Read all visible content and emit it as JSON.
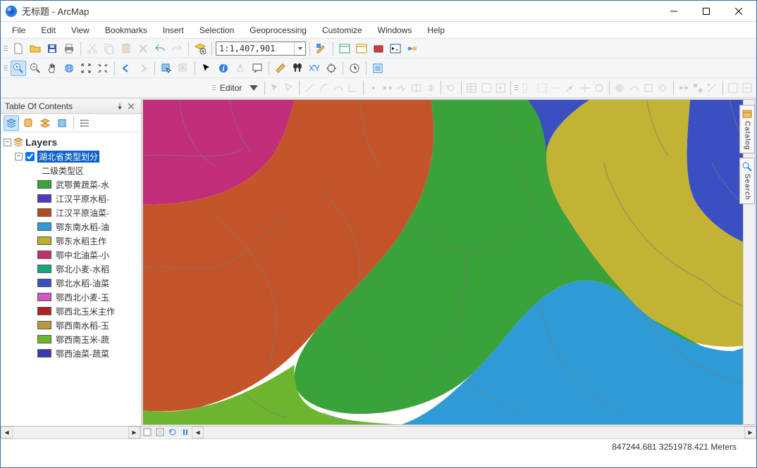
{
  "window": {
    "title": "无标题 - ArcMap"
  },
  "menu": {
    "items": [
      "File",
      "Edit",
      "View",
      "Bookmarks",
      "Insert",
      "Selection",
      "Geoprocessing",
      "Customize",
      "Windows",
      "Help"
    ]
  },
  "scale": {
    "value": "1:1,407,901"
  },
  "editor": {
    "label": "Editor"
  },
  "toc": {
    "title": "Table Of Contents",
    "root": "Layers",
    "layer": "湖北省类型划分",
    "field": "二级类型区",
    "symbols": [
      {
        "color": "#3aa23a",
        "label": "武鄂黄蔬菜-水"
      },
      {
        "color": "#4a3bbf",
        "label": "江汉平原水稻-"
      },
      {
        "color": "#b24a21",
        "label": "江汉平原油菜-"
      },
      {
        "color": "#2e9bd6",
        "label": "鄂东南水稻-油"
      },
      {
        "color": "#b8b02e",
        "label": "鄂东水稻主作"
      },
      {
        "color": "#c22e6e",
        "label": "鄂中北油菜-小"
      },
      {
        "color": "#1aa87a",
        "label": "鄂北小麦-水稻"
      },
      {
        "color": "#3a50c2",
        "label": "鄂北水稻-油菜"
      },
      {
        "color": "#d05ac2",
        "label": "鄂西北小麦-玉"
      },
      {
        "color": "#b02222",
        "label": "鄂西北玉米主作"
      },
      {
        "color": "#b89a3a",
        "label": "鄂西南水稻-玉"
      },
      {
        "color": "#6db52e",
        "label": "鄂西南玉米-蔬"
      },
      {
        "color": "#3a3ab5",
        "label": "鄂西油菜-蔬菜"
      }
    ]
  },
  "sidetabs": {
    "catalog": "Catalog",
    "search": "Search"
  },
  "status": {
    "coords": "847244.681 3251978.421 Meters"
  }
}
